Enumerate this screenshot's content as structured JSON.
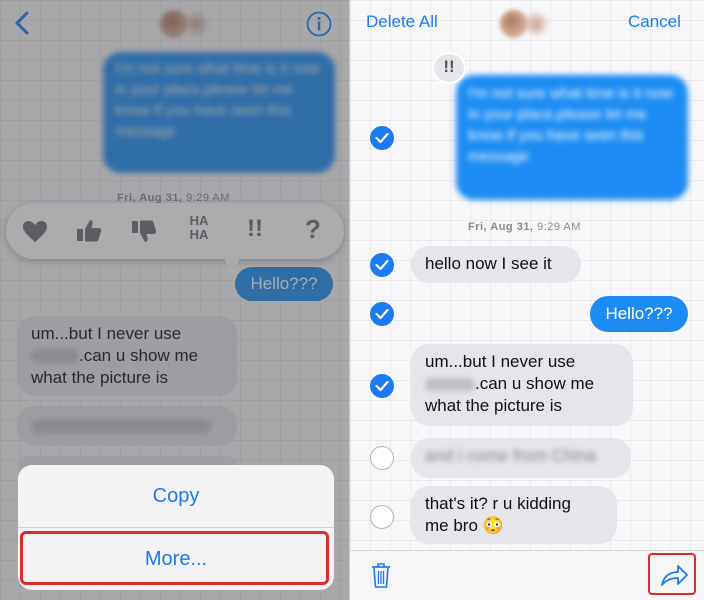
{
  "left": {
    "first_message": "I'm not sure what time is it now in your place,please let me know if you have seen this message",
    "timestamp_day": "Fri, Aug 31,",
    "timestamp_time": "9:29 AM",
    "tapbacks": [
      "heart",
      "thumbs-up",
      "thumbs-down",
      "HA HA",
      "!!",
      "?"
    ],
    "hello": "Hello???",
    "received_line1": "um...but I never use",
    "received_line2": ".can u show me",
    "received_line3": "what the picture is",
    "action_copy": "Copy",
    "action_more": "More..."
  },
  "right": {
    "delete_all": "Delete All",
    "cancel": "Cancel",
    "first_message": "I'm not sure what time is it now in your place,please let me know if you have seen this message",
    "reaction": "!!",
    "timestamp_day": "Fri, Aug 31,",
    "timestamp_time": "9:29 AM",
    "msg_hello_now": "hello now I see it",
    "msg_hello": "Hello???",
    "msg_um1": "um...but I never use",
    "msg_um2": ".can u show me",
    "msg_um3": "what the picture is",
    "msg_blur": "and i come from China",
    "msg_thats1": "that's it?  r u kidding",
    "msg_thats2": "me bro",
    "emoji": "😳"
  },
  "colors": {
    "accent": "#1a7bf2",
    "sent_bubble": "#1d8cf2",
    "received_bubble": "#e5e5ea",
    "highlight": "#e02b2b"
  }
}
